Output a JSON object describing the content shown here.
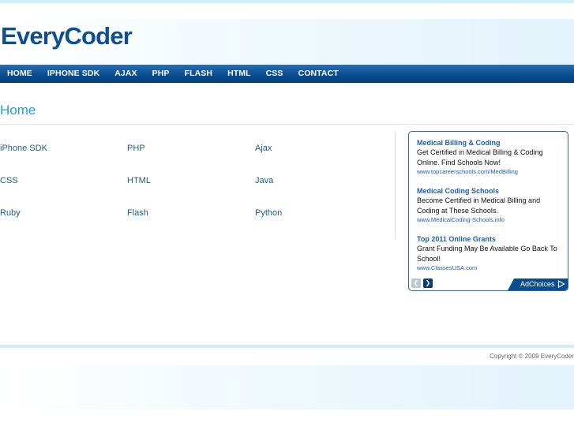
{
  "site": {
    "logo": "EveryCoder"
  },
  "nav": {
    "items": [
      "HOME",
      "IPHONE SDK",
      "AJAX",
      "PHP",
      "FLASH",
      "HTML",
      "CSS",
      "CONTACT"
    ]
  },
  "page": {
    "title": "Home"
  },
  "categories": [
    "iPhone SDK",
    "PHP",
    "Ajax",
    "CSS",
    "HTML",
    "Java",
    "Ruby",
    "Flash",
    "Python"
  ],
  "ads": [
    {
      "title": "Medical Billing & Coding",
      "body": "Get Certified in Medical Billing & Coding Online. Find Schools Now!",
      "url": "www.topcareerschools.com/MedBilling"
    },
    {
      "title": "Medical Coding Schools",
      "body": "Become Certified in Medical Billing and Coding at These Schools.",
      "url": "www.MedicalCoding-Schools.info"
    },
    {
      "title": "Top 2011 Online Grants",
      "body": "Grant Funding May Be Available Go Back To School!",
      "url": "www.ClassesUSA.com"
    }
  ],
  "ad_footer": {
    "prev_glyph": "❮",
    "next_glyph": "❯",
    "adchoices": "AdChoices"
  },
  "footer": {
    "copyright": "Copyright © 2009 EveryCoder"
  }
}
